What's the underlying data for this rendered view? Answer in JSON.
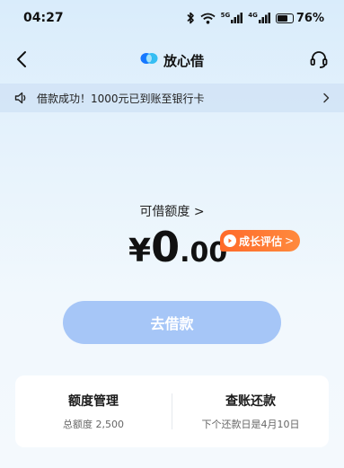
{
  "status_bar": {
    "time": "04:27",
    "network_label": "5G",
    "network_label_2": "4G",
    "battery_percent": "76%",
    "battery_level": 0.76
  },
  "nav": {
    "title": "放心借",
    "back_icon": "chevron-left-icon",
    "service_icon": "headset-icon",
    "brand_color": "#1677ff"
  },
  "notice": {
    "icon": "speaker-icon",
    "text": "借款成功！1000元已到账至银行卡",
    "arrow_icon": "chevron-right-icon"
  },
  "quota": {
    "label": "可借额度 >",
    "currency": "¥",
    "amount_int": "0",
    "amount_dec": ".00",
    "badge_text": "成长评估",
    "badge_arrow": ">",
    "badge_color": "#ff6a2a"
  },
  "borrow_button": {
    "label": "去借款",
    "color": "#a6c6f7"
  },
  "bottom_card": {
    "left_title": "额度管理",
    "left_sub": "总额度 2,500",
    "right_title": "查账还款",
    "right_sub": "下个还款日是4月10日"
  }
}
